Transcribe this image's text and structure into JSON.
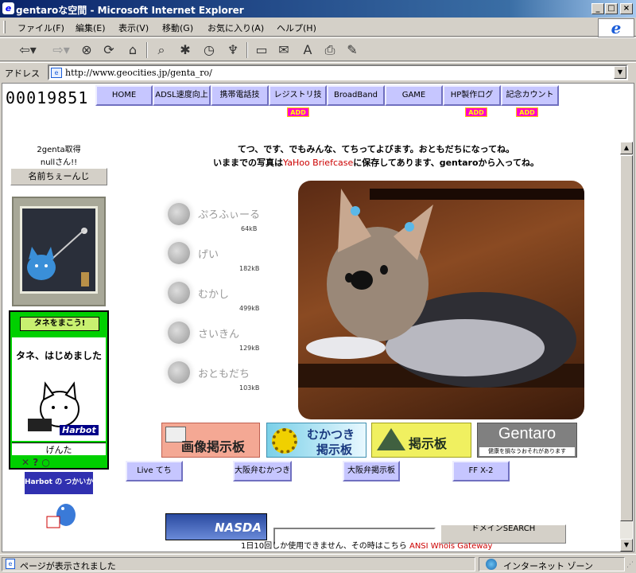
{
  "window": {
    "title": "gentaroな空間 - Microsoft Internet Explorer"
  },
  "menu": [
    "ファイル(F)",
    "編集(E)",
    "表示(V)",
    "移動(G)",
    "お気に入り(A)",
    "ヘルプ(H)"
  ],
  "address": {
    "label": "アドレス",
    "url": "http://www.geocities.jp/genta_ro/"
  },
  "counter": "00019851",
  "nav": [
    "HOME",
    "ADSL速度向上",
    "携帯電話技",
    "レジストリ技",
    "BroadBand",
    "GAME",
    "HP製作ログ",
    "記念カウント"
  ],
  "add_badge": "ADD",
  "sidebar": {
    "greeting": "2genta取得",
    "visitor": "nullさん!!",
    "name_button": "名前ちぇーんじ",
    "banner_title": "タネをまこう!",
    "banner_heading": "タネ、はじめました",
    "banner_brand": "Harbot",
    "pet_name": "げんた",
    "harbot_link": "Harbot の つかいかた"
  },
  "intro": {
    "line1": "てつ、です、でもみんな、てちってよびます。おともだちになってね。",
    "line2_pre": "いままでの写真は",
    "line2_link": "YaHoo Briefcase",
    "line2_post": "に保存してあります、gentaroから入ってね。"
  },
  "photo_links": [
    {
      "label": "ぷろふぃーる",
      "size": "64kB"
    },
    {
      "label": "げい",
      "size": "182kB"
    },
    {
      "label": "むかし",
      "size": "499kB"
    },
    {
      "label": "さいきん",
      "size": "129kB"
    },
    {
      "label": "おともだち",
      "size": "103kB"
    }
  ],
  "banners": {
    "image_board": "画像掲示板",
    "mukatsuki_line1": "むかつき",
    "mukatsuki_line2": "掲示板",
    "board": "掲示板",
    "gentaro": "Gentaro",
    "gentaro_sub": "健康を損なうおそれがあります"
  },
  "bottom_buttons": [
    "Live てち",
    "大阪弁むかつき",
    "大阪弁掲示板",
    "FF X-2"
  ],
  "nasda": "NASDA",
  "search_button": "ドメインSEARCH",
  "footer": {
    "text": "1日10回しか使用できません、その時はこちら",
    "link": "ANSI Whois Gateway"
  },
  "status": {
    "left": "ページが表示されました",
    "zone": "インターネット ゾーン"
  }
}
